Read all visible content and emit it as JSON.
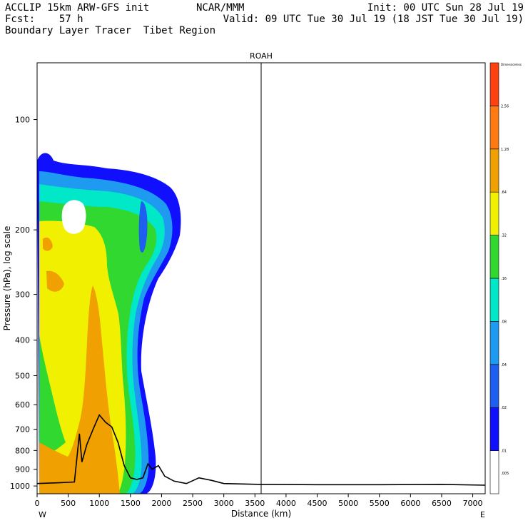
{
  "header": {
    "line1_left": "ACCLIP 15km ARW-GFS init",
    "line1_center": "NCAR/MMM",
    "line1_right": "Init: 00 UTC Sun 28 Jul 19",
    "line2_left": "Fcst:    57 h",
    "line2_right": "Valid: 09 UTC Tue 30 Jul 19 (18 JST Tue 30 Jul 19)",
    "line3_left": "Boundary Layer Tracer  Tibet Region"
  },
  "chart_data": {
    "type": "heatmap",
    "title": "ROAH",
    "xlabel": "Distance (km)",
    "ylabel": "Pressure (hPa), log scale",
    "xlim": [
      0,
      7200
    ],
    "ylim": [
      1050,
      70
    ],
    "y_scale": "log",
    "x_ticks": [
      0,
      500,
      1000,
      1500,
      2000,
      2500,
      3000,
      3500,
      4000,
      4500,
      5000,
      5500,
      6000,
      6500,
      7000
    ],
    "y_ticks": [
      100,
      200,
      300,
      400,
      500,
      600,
      700,
      800,
      900,
      1000
    ],
    "x_end_labels": {
      "left": "W",
      "right": "E"
    },
    "marker_line_x": 3600,
    "colorbar": {
      "unit_label": "Dimensionless",
      "levels": [
        ".005",
        ".01",
        ".02",
        ".04",
        ".08",
        ".16",
        ".32",
        ".64",
        "1.28",
        "2.56"
      ],
      "colors": [
        "#ffffff",
        "#1010ff",
        "#1e5ff0",
        "#1e9bf0",
        "#00e8c8",
        "#30d830",
        "#f0f000",
        "#f0a000",
        "#ff7a10",
        "#ff4010"
      ]
    },
    "series": [
      {
        "name": "terrain",
        "x": [
          0,
          350,
          600,
          680,
          720,
          800,
          900,
          1000,
          1100,
          1200,
          1300,
          1400,
          1500,
          1600,
          1700,
          1780,
          1850,
          1950,
          2050,
          2200,
          2400,
          2600,
          2800,
          3000,
          3600,
          4500,
          5500,
          6500,
          7200
        ],
        "y": [
          985,
          980,
          975,
          720,
          860,
          770,
          700,
          640,
          670,
          690,
          760,
          880,
          950,
          960,
          950,
          870,
          900,
          880,
          940,
          970,
          985,
          950,
          965,
          985,
          990,
          992,
          992,
          990,
          995
        ]
      }
    ]
  }
}
